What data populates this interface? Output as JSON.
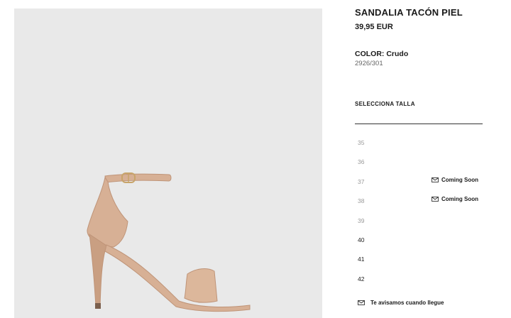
{
  "product": {
    "name": "SANDALIA TACÓN PIEL",
    "price": "39,95 EUR",
    "color_label": "COLOR: Crudo",
    "reference": "2926/301"
  },
  "size_selector": {
    "title": "SELECCIONA TALLA",
    "sizes": [
      {
        "size": "35",
        "available": false,
        "status": ""
      },
      {
        "size": "36",
        "available": false,
        "status": ""
      },
      {
        "size": "37",
        "available": false,
        "status": "Coming Soon"
      },
      {
        "size": "38",
        "available": false,
        "status": "Coming Soon"
      },
      {
        "size": "39",
        "available": false,
        "status": ""
      },
      {
        "size": "40",
        "available": true,
        "status": ""
      },
      {
        "size": "41",
        "available": true,
        "status": ""
      },
      {
        "size": "42",
        "available": true,
        "status": ""
      }
    ],
    "notify_label": "Te avisamos cuando llegue"
  },
  "colors": {
    "image_background": "#e9e9e9",
    "leather": "#d7b095",
    "leather_shadow": "#bf9478",
    "buckle": "#c8a46a"
  },
  "icons": {
    "status_icon": "envelope-icon",
    "notify_icon": "envelope-icon"
  }
}
